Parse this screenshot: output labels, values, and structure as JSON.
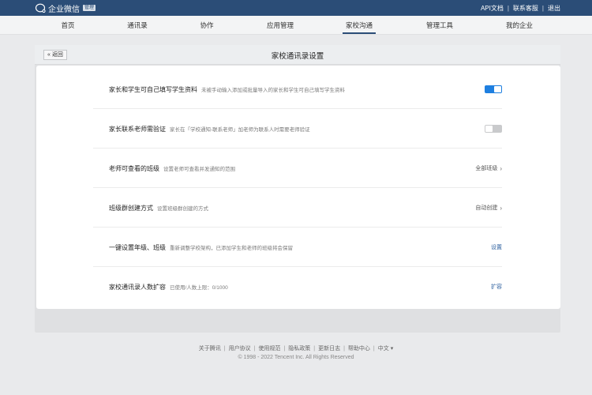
{
  "app": {
    "logo_text": "企业微信",
    "logo_badge": "管理",
    "top_links": [
      "API文档",
      "联系客服",
      "退出"
    ]
  },
  "nav": {
    "items": [
      "首页",
      "通讯录",
      "协作",
      "应用管理",
      "家校沟通",
      "管理工具",
      "我的企业"
    ],
    "active": "家校沟通"
  },
  "panel": {
    "back_label": "« 返回",
    "title": "家校通讯录设置"
  },
  "settings": [
    {
      "title": "家长和学生可自己填写学生资料",
      "desc": "未被手动输入添加或批量导入的家长和学生可自己填写学生资料",
      "control": "toggle",
      "state": "on"
    },
    {
      "title": "家长联系老师需验证",
      "desc": "家长在「学校通知-联系老师」加老师为联系人时需要老师验证",
      "control": "toggle",
      "state": "off"
    },
    {
      "title": "老师可查看的班级",
      "desc": "设置老师可查看并发通知的范围",
      "control": "select",
      "value": "全部班级"
    },
    {
      "title": "班级群创建方式",
      "desc": "设置班级群创建的方式",
      "control": "select",
      "value": "自动创建"
    },
    {
      "title": "一键设置年级、班级",
      "desc": "重新调整学校架构，已添加学生和老师的班级将会保留",
      "control": "link",
      "value": "设置"
    },
    {
      "title": "家校通讯录人数扩容",
      "desc": "已使用/人数上限：0/1000",
      "control": "link",
      "value": "扩容"
    }
  ],
  "footer": {
    "links": [
      "关于腾讯",
      "用户协议",
      "使用规范",
      "隐私政策",
      "更新日志",
      "帮助中心",
      "中文 ▾"
    ],
    "copyright": "© 1998 - 2022 Tencent Inc. All Rights Reserved"
  },
  "colors": {
    "brand": "#2b4d77",
    "toggle_on": "#1e7fe0",
    "link": "#2b5e9e"
  }
}
